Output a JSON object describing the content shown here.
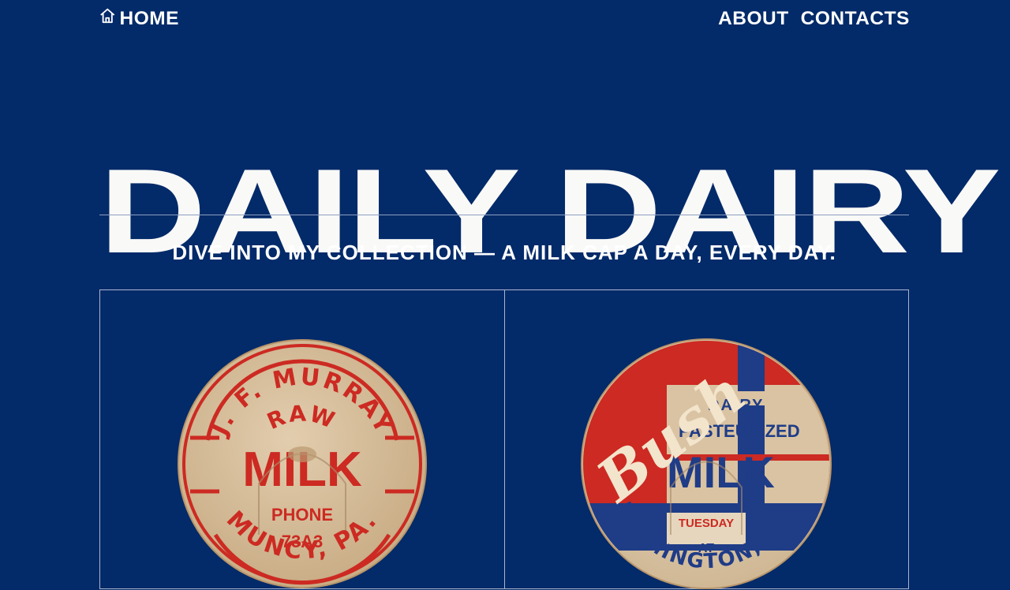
{
  "nav": {
    "home_label": "HOME",
    "about_label": "ABOUT",
    "contacts_label": "CONTACTS",
    "home_icon": "home-icon"
  },
  "hero": {
    "title": "DAILY DAIRY",
    "tagline": "DIVE INTO MY COLLECTION — A MILK CAP A DAY, EVERY DAY."
  },
  "colors": {
    "background": "#032a69",
    "text": "#ffffff",
    "cap_paper": "#d9c3a2",
    "cap_red": "#cc2a22",
    "cap_blue": "#1f3c87"
  },
  "caps": [
    {
      "top_text": "J. F. MURRAY",
      "sub_text": "RAW",
      "main_text": "MILK",
      "line2": "PHONE",
      "line3": "73A3",
      "bottom_text": "MUNCY, PA."
    },
    {
      "script_text": "Bush",
      "top_text": "DAIRY",
      "sub_text": "PASTEURIZED",
      "main_text": "MILK",
      "day_text": "TUESDAY",
      "at_text": "AT",
      "bottom_text": "FLEMINGTON, N.J."
    }
  ]
}
